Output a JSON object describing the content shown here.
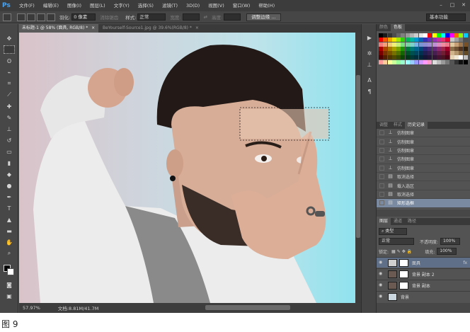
{
  "app_logo": "Ps",
  "menus": [
    "文件(F)",
    "编辑(E)",
    "图像(I)",
    "图层(L)",
    "文字(Y)",
    "选择(S)",
    "滤镜(T)",
    "3D(D)",
    "视图(V)",
    "窗口(W)",
    "帮助(H)"
  ],
  "window_buttons": [
    "–",
    "□",
    "✕"
  ],
  "options": {
    "feather_label": "羽化:",
    "feather_value": "0 像素",
    "antialias_label": "消除锯齿",
    "style_label": "样式:",
    "style_value": "正常",
    "width_label": "宽度:",
    "height_label": "高度:",
    "refine_edge_button": "调整边缘 ...",
    "workspace": "基本功能"
  },
  "tabs": [
    {
      "label": "未标题-1 @ 58% (面具, RGB/8) *",
      "close": "×"
    },
    {
      "label": "BeYourself-Source1.jpg @ 39.6%(RGB/8) *",
      "close": "×"
    }
  ],
  "status": {
    "zoom": "57.97%",
    "doc_info": "文档:8.81M/41.7M"
  },
  "swatches_panel": {
    "tabs": [
      "颜色",
      "色板"
    ],
    "colors": [
      "#000000",
      "#1a1a1a",
      "#333333",
      "#4d4d4d",
      "#666666",
      "#808080",
      "#999999",
      "#b3b3b3",
      "#cccccc",
      "#e6e6e6",
      "#ffffff",
      "#ff0000",
      "#ffff00",
      "#00ff00",
      "#00ffff",
      "#0000ff",
      "#ff00ff",
      "#ff6600",
      "#99ff00",
      "#00ccff",
      "#f20000",
      "#f25a00",
      "#f2a200",
      "#f2e600",
      "#a2e600",
      "#32d200",
      "#00b45a",
      "#00b4a2",
      "#0096d2",
      "#0064b4",
      "#3232b4",
      "#6432b4",
      "#9632b4",
      "#c832a0",
      "#e6326e",
      "#e60032",
      "#c8c8c8",
      "#a0a0a0",
      "#787878",
      "#505050",
      "#f27a7a",
      "#f2a07a",
      "#f2c87a",
      "#f2ee7a",
      "#c8ee7a",
      "#7ae07a",
      "#7ad2a0",
      "#7ad2c8",
      "#7ab4e6",
      "#7a96d2",
      "#8c8cd2",
      "#a08cd2",
      "#be8cd2",
      "#dc8cbe",
      "#f08ca0",
      "#f07a8c",
      "#e0c8a0",
      "#c8a078",
      "#a07850",
      "#785028",
      "#aa0000",
      "#aa4600",
      "#aa7800",
      "#aaa000",
      "#78a000",
      "#1e9600",
      "#00783c",
      "#007878",
      "#00648c",
      "#004678",
      "#282878",
      "#462878",
      "#642878",
      "#8c286e",
      "#a0284b",
      "#a00028",
      "#8c6e4b",
      "#6e5032",
      "#50321e",
      "#32200a",
      "#780000",
      "#783200",
      "#785000",
      "#787000",
      "#507000",
      "#146400",
      "#005028",
      "#005050",
      "#00465f",
      "#003250",
      "#1e1e50",
      "#321e50",
      "#461e50",
      "#641e4b",
      "#701e32",
      "#70001e",
      "#d2b48c",
      "#b4966e",
      "#8c6e46",
      "#644b28",
      "#500000",
      "#502000",
      "#503500",
      "#504a00",
      "#354a00",
      "#0a4600",
      "#003719",
      "#003737",
      "#002d3c",
      "#002337",
      "#141437",
      "#231437",
      "#321437",
      "#461432",
      "#4b1423",
      "#4b0014",
      "#e6d2b4",
      "#f0e6d2",
      "#ffffff",
      "#bebebe",
      "#ff9999",
      "#ffcc99",
      "#ffff99",
      "#ccff99",
      "#99ff99",
      "#99ffcc",
      "#99ffff",
      "#99ccff",
      "#9999ff",
      "#cc99ff",
      "#ff99ff",
      "#ff99cc",
      "#dddddd",
      "#bbbbbb",
      "#999999",
      "#777777",
      "#555555",
      "#333333",
      "#111111",
      "#000000"
    ]
  },
  "history_panel": {
    "tabs": [
      "调整",
      "样式",
      "历史记录"
    ],
    "items": [
      {
        "icon": "stamp",
        "label": "仿制图章"
      },
      {
        "icon": "stamp",
        "label": "仿制图章"
      },
      {
        "icon": "stamp",
        "label": "仿制图章"
      },
      {
        "icon": "stamp",
        "label": "仿制图章"
      },
      {
        "icon": "stamp",
        "label": "仿制图章"
      },
      {
        "icon": "doc",
        "label": "取消选择"
      },
      {
        "icon": "doc",
        "label": "载入选区"
      },
      {
        "icon": "doc",
        "label": "取消选择"
      },
      {
        "icon": "doc",
        "label": "矩形选框"
      }
    ],
    "selected_index": 8
  },
  "layers_panel": {
    "tabs": [
      "图层",
      "通道",
      "路径"
    ],
    "filter_label": "类型",
    "blend_mode": "正常",
    "opacity_label": "不透明度:",
    "opacity_value": "100%",
    "lock_label": "锁定:",
    "fill_label": "填充:",
    "fill_value": "100%",
    "layers": [
      {
        "name": "面具",
        "has_mask": true,
        "fx": "fx",
        "selected": true,
        "thumb": "#cfcfcf"
      },
      {
        "name": "背景 副本 2",
        "has_mask": true,
        "fx": "",
        "selected": false,
        "thumb": "#6b5a52"
      },
      {
        "name": "背景 副本",
        "has_mask": true,
        "fx": "",
        "selected": false,
        "thumb": "#6b5a52"
      },
      {
        "name": "背景",
        "has_mask": false,
        "fx": "",
        "selected": false,
        "thumb": "#c9d6e0"
      }
    ]
  },
  "caption": "图 9"
}
